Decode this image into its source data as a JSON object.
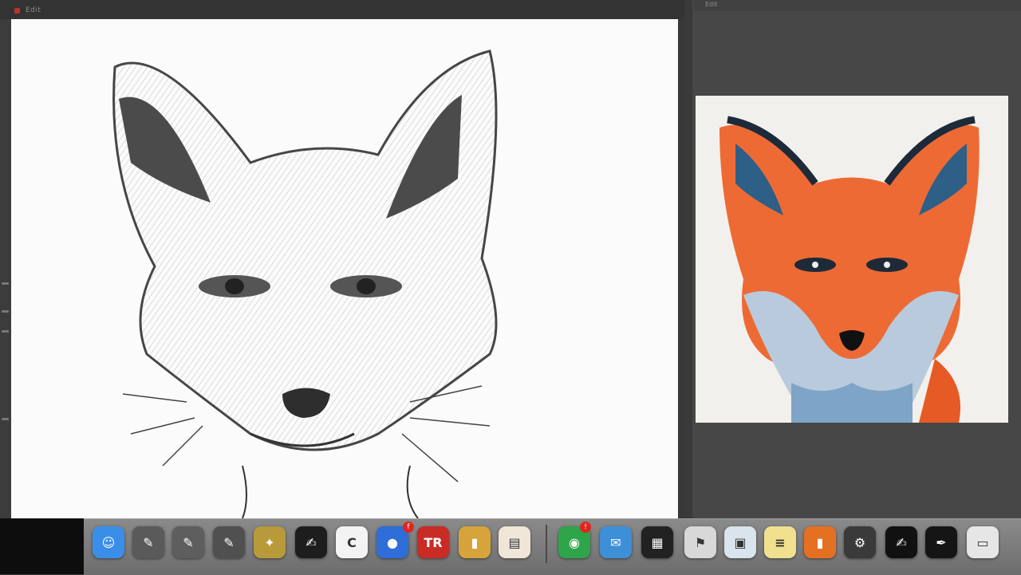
{
  "window": {
    "title": "Edit",
    "canvas_subject": "fox pencil sketch",
    "side_panel_title": "Edit"
  },
  "dock": {
    "items": [
      {
        "name": "finder-icon",
        "glyph": "☺",
        "color": "#3b8ee8"
      },
      {
        "name": "pencil-tool-icon",
        "glyph": "✎",
        "color": "#5a5a5a"
      },
      {
        "name": "pencil-tool-icon-2",
        "glyph": "✎",
        "color": "#5e5e5e"
      },
      {
        "name": "pencil-tool-icon-3",
        "glyph": "✎",
        "color": "#505050"
      },
      {
        "name": "photo-app-icon",
        "glyph": "✦",
        "color": "#b89a3a"
      },
      {
        "name": "sketch-app-icon",
        "glyph": "✍",
        "color": "#1d1d1d"
      },
      {
        "name": "calendar-icon",
        "glyph": "C",
        "color": "#f3f3f3"
      },
      {
        "name": "browser-icon",
        "glyph": "●",
        "color": "#2f6ed8"
      },
      {
        "name": "red-app-icon",
        "glyph": "TR",
        "color": "#c92b25"
      },
      {
        "name": "pencil-cup-icon",
        "glyph": "▮",
        "color": "#d7a43b"
      },
      {
        "name": "scanner-icon",
        "glyph": "▤",
        "color": "#efe6d8"
      },
      {
        "name": "chrome-icon",
        "glyph": "◉",
        "color": "#2fa54a"
      },
      {
        "name": "mail-icon",
        "glyph": "✉",
        "color": "#3d8fd8"
      },
      {
        "name": "terminal-icon",
        "glyph": "▦",
        "color": "#222"
      },
      {
        "name": "flag-app-icon",
        "glyph": "⚑",
        "color": "#d8d8d8"
      },
      {
        "name": "preview-icon",
        "glyph": "▣",
        "color": "#d9e4ec"
      },
      {
        "name": "notes-icon",
        "glyph": "≡",
        "color": "#f1e08e"
      },
      {
        "name": "orange-app-icon",
        "glyph": "▮",
        "color": "#e67022"
      },
      {
        "name": "settings-icon",
        "glyph": "⚙",
        "color": "#3a3a3a"
      },
      {
        "name": "dark-app-icon",
        "glyph": "✍",
        "color": "#111"
      },
      {
        "name": "pen-app-icon",
        "glyph": "✒",
        "color": "#151515"
      },
      {
        "name": "folder-icon",
        "glyph": "▭",
        "color": "#e6e6e6"
      }
    ],
    "badges": [
      {
        "name": "notification-badge",
        "text": "f"
      },
      {
        "name": "notification-badge-2",
        "text": "!"
      }
    ]
  }
}
